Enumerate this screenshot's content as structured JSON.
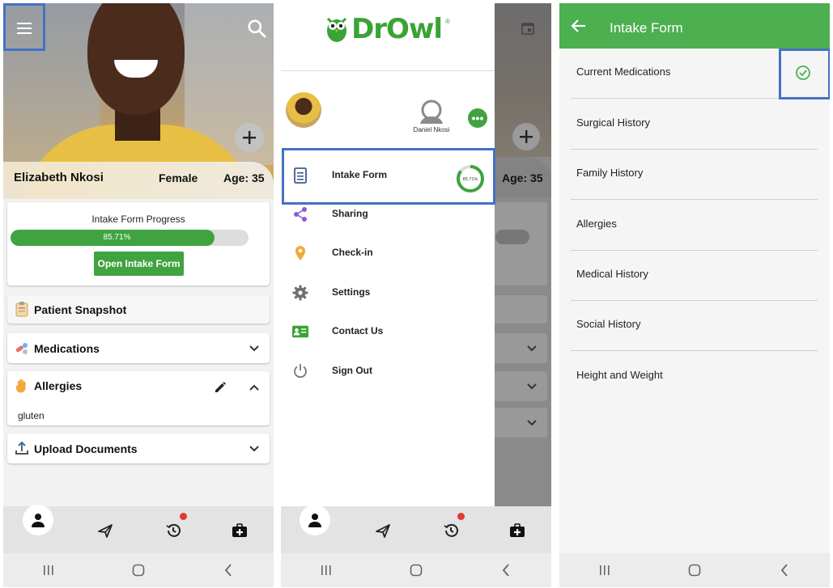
{
  "colors": {
    "accent": "#3fa33f",
    "header": "#4caf50",
    "highlight": "#4472c4",
    "notification": "#e53935"
  },
  "screen1": {
    "patient": {
      "name": "Elizabeth Nkosi",
      "gender": "Female",
      "age": "Age: 35"
    },
    "progress": {
      "title": "Intake Form Progress",
      "label": "85.71%",
      "value": 85.71
    },
    "open_button": "Open Intake Form",
    "sections": {
      "snapshot": "Patient Snapshot",
      "medications": "Medications",
      "allergies": "Allergies",
      "allergy_items": [
        "gluten"
      ],
      "upload": "Upload Documents"
    },
    "icons": {
      "menu": "menu-icon",
      "search": "search-icon",
      "add": "plus-icon"
    }
  },
  "screen2": {
    "logo": "DrOwl",
    "logo_mark": "®",
    "user_name": "Daniel Nkosi",
    "menu": [
      {
        "label": "Intake Form",
        "icon": "form-icon",
        "badge": "85.71%"
      },
      {
        "label": "Sharing",
        "icon": "share-icon"
      },
      {
        "label": "Check-in",
        "icon": "location-pin-icon"
      },
      {
        "label": "Settings",
        "icon": "gear-icon"
      },
      {
        "label": "Contact Us",
        "icon": "contact-card-icon"
      },
      {
        "label": "Sign Out",
        "icon": "power-icon"
      }
    ],
    "intake_progress": 85.71,
    "background_age": "Age: 35"
  },
  "screen3": {
    "title": "Intake Form",
    "items": [
      {
        "label": "Current Medications",
        "completed": true
      },
      {
        "label": "Surgical History",
        "completed": false
      },
      {
        "label": "Family History",
        "completed": false
      },
      {
        "label": "Allergies",
        "completed": false
      },
      {
        "label": "Medical History",
        "completed": false
      },
      {
        "label": "Social History",
        "completed": false
      },
      {
        "label": "Height and Weight",
        "completed": false
      }
    ]
  },
  "bottom_nav": [
    "profile-icon",
    "send-icon",
    "history-icon",
    "medical-kit-icon"
  ],
  "system_nav": [
    "recent-apps-icon",
    "home-icon",
    "back-icon"
  ]
}
